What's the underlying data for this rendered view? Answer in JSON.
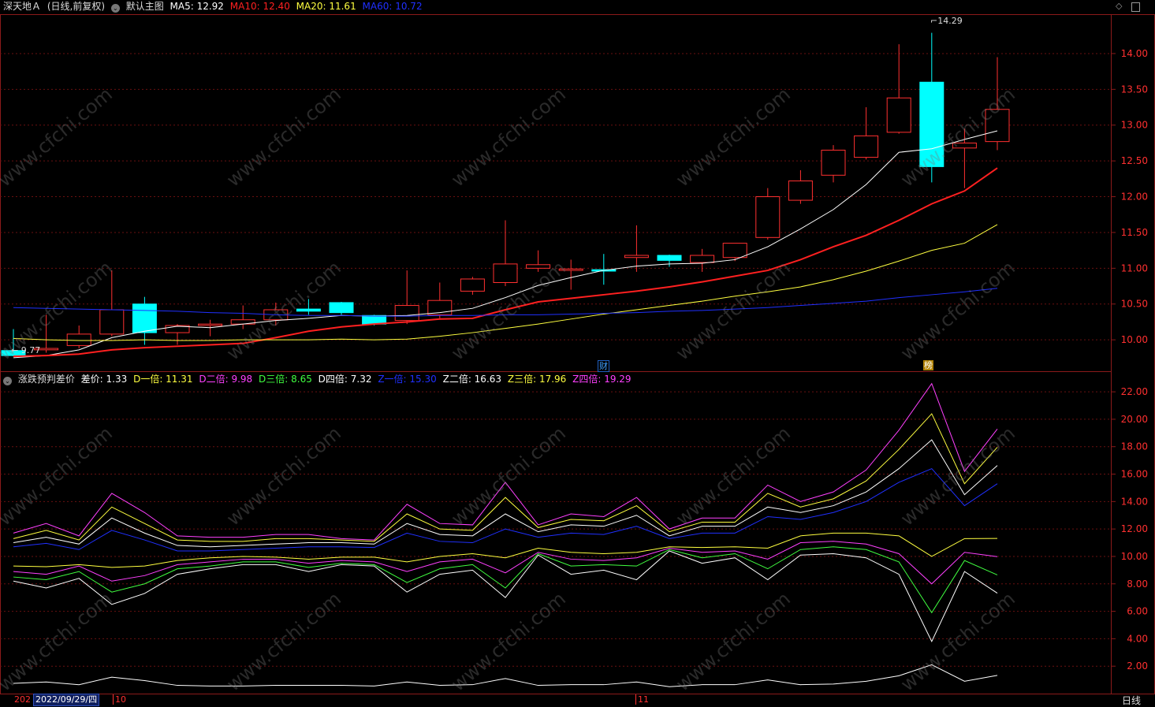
{
  "header_top": {
    "stock": "深天地Ａ",
    "mode": "(日线,前复权)",
    "indicator": "默认主图",
    "ma": [
      {
        "label": "MA5: 12.92",
        "color": "#ffffff"
      },
      {
        "label": "MA10: 12.40",
        "color": "#ff2020"
      },
      {
        "label": "MA20: 11.61",
        "color": "#ffff40"
      },
      {
        "label": "MA60: 10.72",
        "color": "#2030ff"
      }
    ]
  },
  "header_bottom": {
    "indicator": "涨跌预判差价",
    "items": [
      {
        "label": "差价: 1.33",
        "color": "#ffffff"
      },
      {
        "label": "D一倍: 11.31",
        "color": "#ffff40"
      },
      {
        "label": "D二倍: 9.98",
        "color": "#ff40ff"
      },
      {
        "label": "D三倍: 8.65",
        "color": "#40ff40"
      },
      {
        "label": "D四倍: 7.32",
        "color": "#ffffff"
      },
      {
        "label": "Z一倍: 15.30",
        "color": "#2030ff"
      },
      {
        "label": "Z二倍: 16.63",
        "color": "#ffffff"
      },
      {
        "label": "Z三倍: 17.96",
        "color": "#ffff40"
      },
      {
        "label": "Z四倍: 19.29",
        "color": "#ff40ff"
      }
    ]
  },
  "annotations": {
    "high_label": "14.29",
    "low_label": "9.77",
    "event1": "财",
    "event2": "榜"
  },
  "footer": {
    "date_prefix": "202",
    "date": "2022/09/29/四",
    "month1": "10",
    "month2": "11",
    "period_button": "日线"
  },
  "watermark": "www.cfchi.com",
  "chart_data": [
    {
      "type": "candlestick",
      "title": "深天地Ａ (日线,前复权)",
      "ylim": [
        9.55,
        14.55
      ],
      "yticks": [
        "10.00",
        "10.50",
        "11.00",
        "11.50",
        "12.00",
        "12.50",
        "13.00",
        "13.50",
        "14.00"
      ],
      "candles": [
        {
          "o": 9.85,
          "h": 10.15,
          "l": 9.77,
          "c": 9.78
        },
        {
          "o": 9.86,
          "h": 10.35,
          "l": 9.82,
          "c": 9.88
        },
        {
          "o": 9.92,
          "h": 10.2,
          "l": 9.88,
          "c": 10.08
        },
        {
          "o": 10.08,
          "h": 10.97,
          "l": 10.05,
          "c": 10.42
        },
        {
          "o": 10.5,
          "h": 10.6,
          "l": 9.93,
          "c": 10.1
        },
        {
          "o": 10.1,
          "h": 10.22,
          "l": 9.93,
          "c": 10.2
        },
        {
          "o": 10.2,
          "h": 10.28,
          "l": 10.05,
          "c": 10.22
        },
        {
          "o": 10.22,
          "h": 10.48,
          "l": 10.15,
          "c": 10.28
        },
        {
          "o": 10.28,
          "h": 10.52,
          "l": 10.2,
          "c": 10.42
        },
        {
          "o": 10.43,
          "h": 10.57,
          "l": 10.35,
          "c": 10.4
        },
        {
          "o": 10.52,
          "h": 10.53,
          "l": 10.35,
          "c": 10.38
        },
        {
          "o": 10.34,
          "h": 10.35,
          "l": 10.2,
          "c": 10.22
        },
        {
          "o": 10.27,
          "h": 10.97,
          "l": 10.22,
          "c": 10.48
        },
        {
          "o": 10.35,
          "h": 10.8,
          "l": 10.3,
          "c": 10.55
        },
        {
          "o": 10.68,
          "h": 10.88,
          "l": 10.63,
          "c": 10.85
        },
        {
          "o": 10.8,
          "h": 11.67,
          "l": 10.75,
          "c": 11.06
        },
        {
          "o": 11.0,
          "h": 11.25,
          "l": 10.95,
          "c": 11.05
        },
        {
          "o": 10.97,
          "h": 11.12,
          "l": 10.7,
          "c": 10.99
        },
        {
          "o": 10.98,
          "h": 11.2,
          "l": 10.77,
          "c": 10.96
        },
        {
          "o": 11.15,
          "h": 11.6,
          "l": 10.95,
          "c": 11.18
        },
        {
          "o": 11.18,
          "h": 11.19,
          "l": 11.02,
          "c": 11.11
        },
        {
          "o": 11.08,
          "h": 11.27,
          "l": 10.95,
          "c": 11.18
        },
        {
          "o": 11.15,
          "h": 11.35,
          "l": 11.1,
          "c": 11.35
        },
        {
          "o": 11.43,
          "h": 12.12,
          "l": 11.4,
          "c": 12.0
        },
        {
          "o": 11.95,
          "h": 12.37,
          "l": 11.9,
          "c": 12.22
        },
        {
          "o": 12.3,
          "h": 12.72,
          "l": 12.2,
          "c": 12.65
        },
        {
          "o": 12.55,
          "h": 13.25,
          "l": 12.52,
          "c": 12.85
        },
        {
          "o": 12.9,
          "h": 14.13,
          "l": 12.88,
          "c": 13.38
        },
        {
          "o": 13.6,
          "h": 14.29,
          "l": 12.2,
          "c": 12.42
        },
        {
          "o": 12.68,
          "h": 12.95,
          "l": 12.12,
          "c": 12.75
        },
        {
          "o": 12.77,
          "h": 13.95,
          "l": 12.65,
          "c": 13.22
        }
      ],
      "series": [
        {
          "name": "MA5",
          "color": "#ffffff",
          "values": [
            9.75,
            9.78,
            9.86,
            10.03,
            10.12,
            10.19,
            10.17,
            10.22,
            10.27,
            10.3,
            10.34,
            10.33,
            10.34,
            10.38,
            10.44,
            10.59,
            10.76,
            10.87,
            10.97,
            11.03,
            11.06,
            11.07,
            11.12,
            11.3,
            11.55,
            11.82,
            12.17,
            12.62,
            12.67,
            12.8,
            12.92
          ]
        },
        {
          "name": "MA10",
          "color": "#ff2020",
          "values": [
            9.77,
            9.78,
            9.8,
            9.86,
            9.89,
            9.91,
            9.93,
            9.95,
            10.03,
            10.12,
            10.18,
            10.22,
            10.25,
            10.29,
            10.3,
            10.42,
            10.53,
            10.58,
            10.63,
            10.68,
            10.74,
            10.81,
            10.89,
            10.97,
            11.12,
            11.3,
            11.46,
            11.67,
            11.9,
            12.08,
            12.4
          ]
        },
        {
          "name": "MA20",
          "color": "#ffff40",
          "values": [
            10.02,
            10.0,
            9.99,
            9.99,
            10.0,
            9.99,
            9.99,
            10.0,
            10.0,
            10.0,
            10.01,
            10.0,
            10.01,
            10.05,
            10.1,
            10.16,
            10.22,
            10.29,
            10.36,
            10.42,
            10.48,
            10.54,
            10.61,
            10.67,
            10.74,
            10.84,
            10.96,
            11.1,
            11.25,
            11.35,
            11.61
          ]
        },
        {
          "name": "MA60",
          "color": "#2030ff",
          "values": [
            10.45,
            10.44,
            10.43,
            10.42,
            10.41,
            10.4,
            10.38,
            10.37,
            10.35,
            10.34,
            10.34,
            10.33,
            10.33,
            10.34,
            10.34,
            10.35,
            10.35,
            10.36,
            10.37,
            10.38,
            10.4,
            10.41,
            10.43,
            10.45,
            10.48,
            10.51,
            10.54,
            10.59,
            10.63,
            10.67,
            10.72
          ]
        }
      ]
    },
    {
      "type": "line",
      "title": "涨跌预判差价",
      "ylim": [
        0,
        23.5
      ],
      "yticks": [
        "2.00",
        "4.00",
        "6.00",
        "8.00",
        "10.00",
        "12.00",
        "14.00",
        "16.00",
        "18.00",
        "20.00",
        "22.00"
      ],
      "series": [
        {
          "name": "差价",
          "color": "#ffffff",
          "values": [
            0.75,
            0.85,
            0.65,
            1.2,
            0.95,
            0.6,
            0.55,
            0.55,
            0.6,
            0.6,
            0.6,
            0.55,
            0.85,
            0.6,
            0.65,
            1.1,
            0.6,
            0.65,
            0.65,
            0.85,
            0.5,
            0.65,
            0.65,
            1.0,
            0.65,
            0.7,
            0.9,
            1.3,
            2.1,
            0.9,
            1.33
          ]
        },
        {
          "name": "D一倍",
          "color": "#ffff40",
          "values": [
            9.3,
            9.25,
            9.4,
            9.2,
            9.3,
            9.7,
            9.9,
            10.0,
            9.95,
            9.8,
            9.95,
            9.95,
            9.6,
            10.0,
            10.2,
            9.9,
            10.6,
            10.3,
            10.2,
            10.3,
            10.7,
            10.65,
            10.7,
            10.6,
            11.5,
            11.7,
            11.7,
            11.5,
            10.0,
            11.3,
            11.31
          ]
        },
        {
          "name": "D二倍",
          "color": "#ff40ff",
          "values": [
            8.9,
            8.7,
            9.3,
            8.2,
            8.6,
            9.4,
            9.6,
            9.8,
            9.8,
            9.5,
            9.7,
            9.6,
            8.9,
            9.6,
            9.8,
            8.8,
            10.3,
            9.8,
            9.7,
            9.9,
            10.6,
            10.3,
            10.4,
            9.8,
            11.0,
            11.1,
            10.9,
            10.2,
            8.0,
            10.3,
            9.98
          ]
        },
        {
          "name": "D三倍",
          "color": "#40ff40",
          "values": [
            8.5,
            8.3,
            8.9,
            7.4,
            8.0,
            9.1,
            9.3,
            9.6,
            9.6,
            9.2,
            9.5,
            9.4,
            8.1,
            9.1,
            9.4,
            7.7,
            10.2,
            9.3,
            9.4,
            9.3,
            10.5,
            9.9,
            10.2,
            9.1,
            10.5,
            10.7,
            10.5,
            9.6,
            5.9,
            9.7,
            8.65
          ]
        },
        {
          "name": "D四倍",
          "color": "#ffffff",
          "values": [
            8.2,
            7.7,
            8.4,
            6.5,
            7.3,
            8.7,
            9.1,
            9.4,
            9.4,
            8.9,
            9.4,
            9.3,
            7.4,
            8.7,
            9.0,
            7.0,
            10.1,
            8.7,
            9.0,
            8.3,
            10.4,
            9.5,
            9.9,
            8.3,
            10.1,
            10.2,
            9.9,
            8.7,
            3.8,
            8.9,
            7.32
          ]
        },
        {
          "name": "Z一倍",
          "color": "#2030ff",
          "values": [
            10.7,
            10.95,
            10.5,
            11.9,
            11.2,
            10.4,
            10.4,
            10.5,
            10.6,
            10.7,
            10.7,
            10.65,
            11.7,
            11.1,
            11.0,
            12.0,
            11.4,
            11.7,
            11.6,
            12.2,
            11.3,
            11.7,
            11.7,
            12.9,
            12.7,
            13.2,
            14.0,
            15.4,
            16.4,
            13.7,
            15.3
          ]
        },
        {
          "name": "Z二倍",
          "color": "#ffffff",
          "values": [
            11.0,
            11.4,
            10.9,
            12.8,
            11.7,
            10.8,
            10.7,
            10.8,
            10.9,
            11.0,
            11.0,
            10.9,
            12.4,
            11.6,
            11.5,
            13.1,
            11.8,
            12.3,
            12.2,
            13.0,
            11.5,
            12.2,
            12.2,
            13.6,
            13.2,
            13.7,
            14.7,
            16.4,
            18.5,
            14.5,
            16.63
          ]
        },
        {
          "name": "Z三倍",
          "color": "#ffff40",
          "values": [
            11.3,
            11.9,
            11.2,
            13.6,
            12.4,
            11.2,
            11.1,
            11.1,
            11.3,
            11.3,
            11.2,
            11.1,
            13.1,
            12.0,
            11.9,
            14.3,
            12.1,
            12.7,
            12.6,
            13.7,
            11.8,
            12.5,
            12.5,
            14.6,
            13.6,
            14.2,
            15.5,
            17.8,
            20.4,
            15.3,
            17.96
          ]
        },
        {
          "name": "Z四倍",
          "color": "#ff40ff",
          "values": [
            11.7,
            12.4,
            11.5,
            14.6,
            13.2,
            11.5,
            11.4,
            11.4,
            11.6,
            11.6,
            11.3,
            11.2,
            13.8,
            12.4,
            12.3,
            15.4,
            12.3,
            13.1,
            12.9,
            14.3,
            12.0,
            12.8,
            12.8,
            15.2,
            14.0,
            14.7,
            16.3,
            19.2,
            22.6,
            16.2,
            19.29
          ]
        }
      ]
    }
  ]
}
